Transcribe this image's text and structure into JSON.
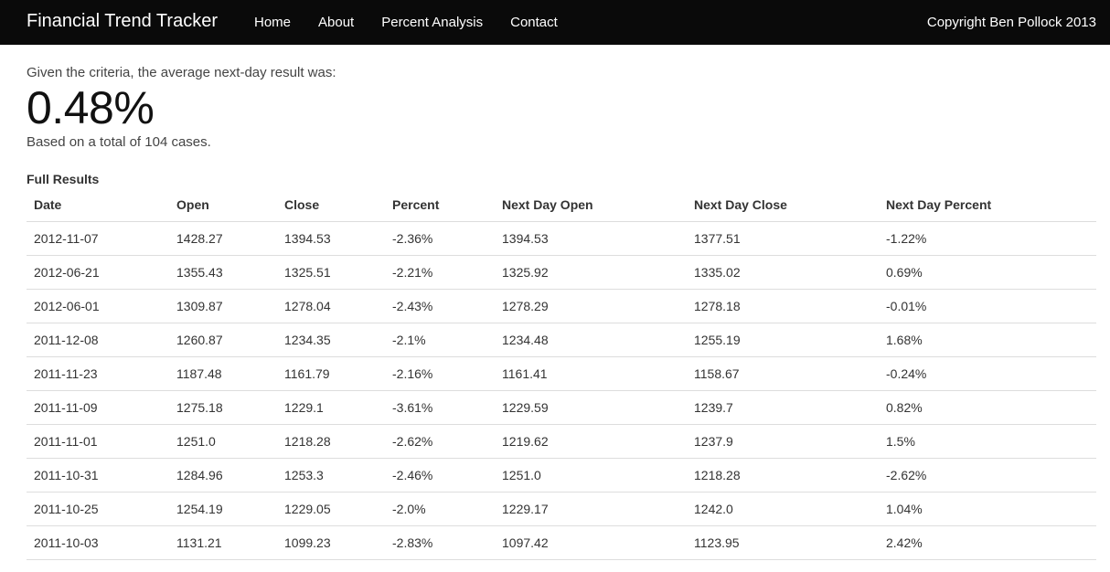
{
  "navbar": {
    "brand": "Financial Trend Tracker",
    "links": [
      "Home",
      "About",
      "Percent Analysis",
      "Contact"
    ],
    "copyright": "Copyright Ben Pollock 2013",
    "background": "#0a0a0a"
  },
  "summary": {
    "criteria_text": "Given the criteria, the average next-day result was:",
    "average_result": "0.48%",
    "cases_text": "Based on a total of 104 cases."
  },
  "results": {
    "heading": "Full Results",
    "columns": [
      "Date",
      "Open",
      "Close",
      "Percent",
      "Next Day Open",
      "Next Day Close",
      "Next Day Percent"
    ],
    "rows": [
      [
        "2012-11-07",
        "1428.27",
        "1394.53",
        "-2.36%",
        "1394.53",
        "1377.51",
        "-1.22%"
      ],
      [
        "2012-06-21",
        "1355.43",
        "1325.51",
        "-2.21%",
        "1325.92",
        "1335.02",
        "0.69%"
      ],
      [
        "2012-06-01",
        "1309.87",
        "1278.04",
        "-2.43%",
        "1278.29",
        "1278.18",
        "-0.01%"
      ],
      [
        "2011-12-08",
        "1260.87",
        "1234.35",
        "-2.1%",
        "1234.48",
        "1255.19",
        "1.68%"
      ],
      [
        "2011-11-23",
        "1187.48",
        "1161.79",
        "-2.16%",
        "1161.41",
        "1158.67",
        "-0.24%"
      ],
      [
        "2011-11-09",
        "1275.18",
        "1229.1",
        "-3.61%",
        "1229.59",
        "1239.7",
        "0.82%"
      ],
      [
        "2011-11-01",
        "1251.0",
        "1218.28",
        "-2.62%",
        "1219.62",
        "1237.9",
        "1.5%"
      ],
      [
        "2011-10-31",
        "1284.96",
        "1253.3",
        "-2.46%",
        "1251.0",
        "1218.28",
        "-2.62%"
      ],
      [
        "2011-10-25",
        "1254.19",
        "1229.05",
        "-2.0%",
        "1229.17",
        "1242.0",
        "1.04%"
      ],
      [
        "2011-10-03",
        "1131.21",
        "1099.23",
        "-2.83%",
        "1097.42",
        "1123.95",
        "2.42%"
      ]
    ]
  }
}
